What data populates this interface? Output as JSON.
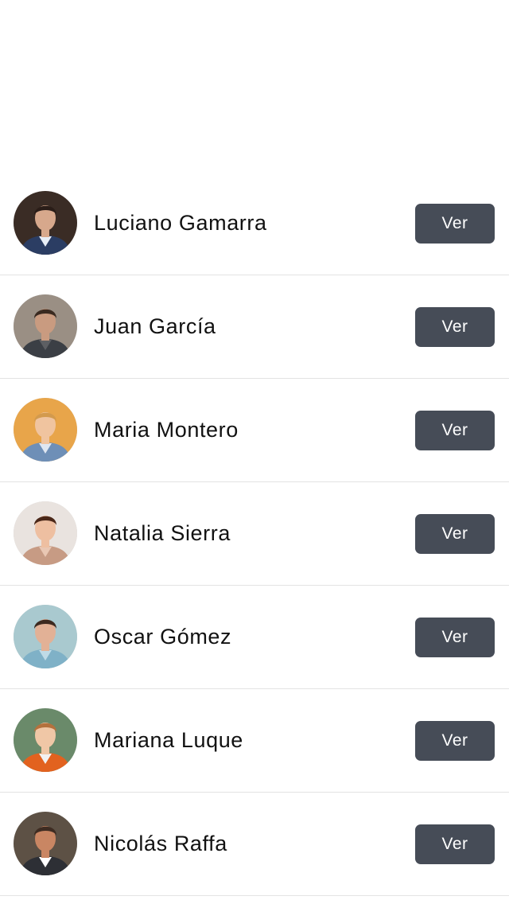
{
  "contacts": [
    {
      "name": "Luciano Gamarra",
      "button_label": "Ver",
      "avatar": {
        "bg": "#3a2c25",
        "skin": "#d7a88c",
        "hair": "#2a1d18",
        "shirt": "#2b3d63",
        "collar": "#e8eef7"
      }
    },
    {
      "name": "Juan García",
      "button_label": "Ver",
      "avatar": {
        "bg": "#9a8f84",
        "skin": "#c99b80",
        "hair": "#3a2a20",
        "shirt": "#3b3f45",
        "collar": "#5d5f63"
      }
    },
    {
      "name": "Maria Montero",
      "button_label": "Ver",
      "avatar": {
        "bg": "#e8a54a",
        "skin": "#f0c49f",
        "hair": "#d39a4d",
        "shirt": "#6e8fb7",
        "collar": "#dfe7f2"
      }
    },
    {
      "name": "Natalia Sierra",
      "button_label": "Ver",
      "avatar": {
        "bg": "#e9e3df",
        "skin": "#eebfa1",
        "hair": "#4a2718",
        "shirt": "#c79b84",
        "collar": "#e9c7b3"
      }
    },
    {
      "name": "Oscar Gómez",
      "button_label": "Ver",
      "avatar": {
        "bg": "#a9c9cf",
        "skin": "#e2b196",
        "hair": "#3d2a20",
        "shirt": "#7fb1c7",
        "collar": "#bfdbe7"
      }
    },
    {
      "name": "Mariana Luque",
      "button_label": "Ver",
      "avatar": {
        "bg": "#6a8a6a",
        "skin": "#f0c7a6",
        "hair": "#b4713d",
        "shirt": "#e2621f",
        "collar": "#f2f2f2"
      }
    },
    {
      "name": "Nicolás Raffa",
      "button_label": "Ver",
      "avatar": {
        "bg": "#5d5145",
        "skin": "#c98663",
        "hair": "#3e2c22",
        "shirt": "#2d2f35",
        "collar": "#ffffff"
      }
    }
  ]
}
